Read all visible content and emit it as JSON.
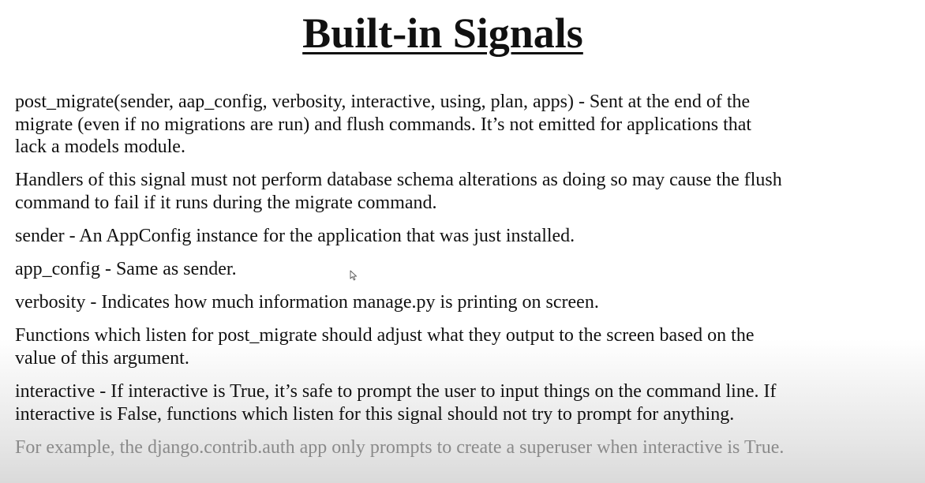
{
  "title": "Built-in Signals",
  "paragraphs": [
    {
      "lines": [
        "post_migrate(sender, aap_config, verbosity, interactive, using, plan, apps) -  Sent at the end of the",
        "migrate (even if no migrations are run) and flush commands. It’s not emitted for applications that",
        "lack a models module."
      ]
    },
    {
      "lines": [
        "Handlers of this signal must not perform database schema alterations as doing so may cause the flush",
        "command to fail if it runs during the migrate command."
      ]
    },
    {
      "lines": [
        "sender - An AppConfig instance for the application that was just installed."
      ]
    },
    {
      "lines": [
        "app_config - Same as sender."
      ]
    },
    {
      "lines": [
        "verbosity - Indicates how much information manage.py is printing on screen."
      ]
    },
    {
      "lines": [
        "Functions which listen for post_migrate should adjust what they output to the screen based on the",
        "value of this argument."
      ]
    },
    {
      "lines": [
        "interactive - If interactive is True, it’s safe to prompt the user to input things on the command line. If",
        "interactive is False, functions which listen for this signal should not try to prompt for anything."
      ]
    },
    {
      "lines": [
        "For example, the django.contrib.auth app only prompts to create a superuser when interactive is True."
      ]
    }
  ],
  "icons": {
    "cursor": "mouse-pointer-icon"
  }
}
